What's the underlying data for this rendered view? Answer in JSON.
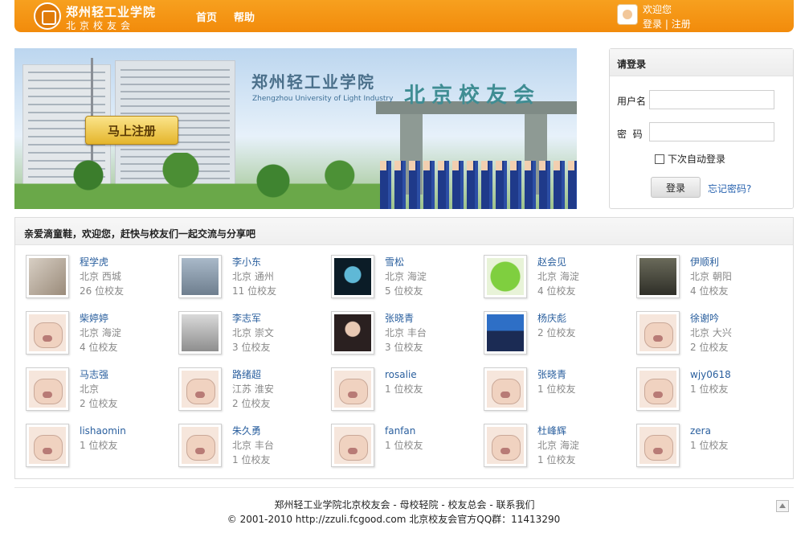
{
  "header": {
    "logo_cn": "郑州轻工业学院",
    "logo_sub": "北京校友会",
    "nav": [
      "首页",
      "帮助"
    ],
    "welcome": "欢迎您",
    "login_link": "登录",
    "separator": "|",
    "register_link": "注册"
  },
  "banner": {
    "calligraphy": "郑州轻工业学院",
    "english": "Zhengzhou University of Light Industry",
    "title": "北京校友会",
    "register_button": "马上注册"
  },
  "login": {
    "title": "请登录",
    "username_label": "用户名",
    "password_label": "密  码",
    "username_value": "",
    "password_value": "",
    "remember_label": "下次自动登录",
    "login_button": "登录",
    "forgot_link": "忘记密码?"
  },
  "friends": {
    "heading": "亲爱滴童鞋，欢迎您，赶快与校友们一起交流与分享吧",
    "items": [
      {
        "name": "程学虎",
        "location": "北京 西城",
        "count": "26 位校友",
        "avatar": "ph-a"
      },
      {
        "name": "李小东",
        "location": "北京 通州",
        "count": "11 位校友",
        "avatar": "ph-b"
      },
      {
        "name": "雪松",
        "location": "北京 海淀",
        "count": "5 位校友",
        "avatar": "ph-c"
      },
      {
        "name": "赵会见",
        "location": "北京 海淀",
        "count": "4 位校友",
        "avatar": "ph-d"
      },
      {
        "name": "伊顺利",
        "location": "北京 朝阳",
        "count": "4 位校友",
        "avatar": "ph-e"
      },
      {
        "name": "柴婷婷",
        "location": "北京 海淀",
        "count": "4 位校友",
        "avatar": "pig"
      },
      {
        "name": "李志军",
        "location": "北京 崇文",
        "count": "3 位校友",
        "avatar": "ph-f"
      },
      {
        "name": "张晓青",
        "location": "北京 丰台",
        "count": "3 位校友",
        "avatar": "ph-g"
      },
      {
        "name": "杨庆彪",
        "location": "",
        "count": "2 位校友",
        "avatar": "ph-h"
      },
      {
        "name": "徐谢吟",
        "location": "北京 大兴",
        "count": "2 位校友",
        "avatar": "pig"
      },
      {
        "name": "马志强",
        "location": "北京",
        "count": "2 位校友",
        "avatar": "pig"
      },
      {
        "name": "路绪超",
        "location": "江苏 淮安",
        "count": "2 位校友",
        "avatar": "pig"
      },
      {
        "name": "rosalie",
        "location": "",
        "count": "1 位校友",
        "avatar": "pig"
      },
      {
        "name": "张晓青",
        "location": "",
        "count": "1 位校友",
        "avatar": "pig"
      },
      {
        "name": "wjy0618",
        "location": "",
        "count": "1 位校友",
        "avatar": "pig"
      },
      {
        "name": "lishaomin",
        "location": "",
        "count": "1 位校友",
        "avatar": "pig"
      },
      {
        "name": "朱久勇",
        "location": "北京 丰台",
        "count": "1 位校友",
        "avatar": "pig"
      },
      {
        "name": "fanfan",
        "location": "",
        "count": "1 位校友",
        "avatar": "pig"
      },
      {
        "name": "杜峰辉",
        "location": "北京 海淀",
        "count": "1 位校友",
        "avatar": "pig"
      },
      {
        "name": "zera",
        "location": "",
        "count": "1 位校友",
        "avatar": "pig"
      }
    ]
  },
  "footer": {
    "links": [
      "郑州轻工业学院北京校友会",
      "母校轻院",
      "校友总会",
      "联系我们"
    ],
    "separator": " - ",
    "copyright": "© 2001-2010 http://zzuli.fcgood.com 北京校友会官方QQ群：11413290"
  },
  "colors": {
    "brand_orange": "#f28b0b",
    "link_blue": "#2a5f9e"
  }
}
